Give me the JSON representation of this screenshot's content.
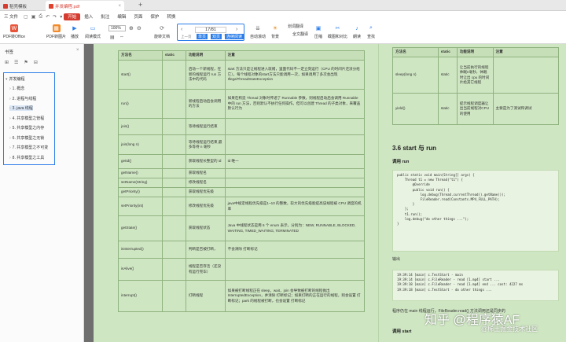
{
  "tabs": {
    "home_label": "稻壳模板",
    "doc_label": "并发编程.pdf",
    "add_label": "+"
  },
  "menu": {
    "file_label": "三 文件",
    "items": [
      "开始",
      "插入",
      "批注",
      "编辑",
      "页面",
      "保护",
      "转换"
    ],
    "active_index": 0
  },
  "toolbar": {
    "pdf_to_office": "PDF转Office",
    "pdf_to_image": "PDF转图片",
    "play": "播放",
    "read_mode": "阅读模式",
    "zoom": "100%",
    "rotate": "旋转文档",
    "single": "单页",
    "double": "双页",
    "continuous": "连续阅读",
    "autoscroll": "自动滚动",
    "background": "背景",
    "fulltext_translate": "全文翻译",
    "compress": "压缩",
    "screenshot_compare": "截图和对比",
    "read_aloud": "朗读",
    "find": "查找",
    "word_translate": "划词翻译",
    "page_current": "17",
    "page_total": "/81",
    "prev_label": "上一页",
    "next_label": "下一页"
  },
  "sidebar": {
    "title": "书签",
    "root": "并发编程",
    "items": [
      "1. 概念",
      "2. 进程与线程",
      "3. java 线程",
      "4. 共享模型之管程",
      "5. 共享模型之内存",
      "6. 共享模型之无锁",
      "7. 共享模型之不可变",
      "8. 共享模型之工具"
    ]
  },
  "table_main": {
    "headers": [
      "方法名",
      "static",
      "功能说明",
      "注意"
    ],
    "rows": [
      [
        "start()",
        "",
        "启动一个新线程，在新的线程运行 run 方法中的代码",
        "start 方法只是让线程进入就绪，里面代码不一定立刻运行（CPU 的时间片还没分给它）。每个线程对象的start方法只能调用一次，如果调用了多次会出现IllegalThreadStateException"
      ],
      [
        "run()",
        "",
        "新线程启动后会调用的方法",
        "如果在构造 Thread 对象时传递了 Runnable 参数，则线程启动后会调用 Runnable 中的 run 方法，否则默认不执行任何操作。但可以创建 Thread 的子类对象，来覆盖默认行为"
      ],
      [
        "join()",
        "",
        "等待线程运行结束",
        ""
      ],
      [
        "join(long n)",
        "",
        "等待线程运行结束,最多等待 n 毫秒",
        ""
      ],
      [
        "getId()",
        "",
        "获取线程长整型的 id",
        "id 唯一"
      ],
      [
        "getName()",
        "",
        "获取线程名",
        ""
      ],
      [
        "setName(String)",
        "",
        "修改线程名",
        ""
      ],
      [
        "getPriority()",
        "",
        "获取线程优先级",
        ""
      ],
      [
        "setPriority(int)",
        "",
        "修改线程优先级",
        "java中规定线程优先级是1~10 的整数，较大的优先级能提高该线程被 CPU 调度的机率"
      ],
      [
        "getState()",
        "",
        "获取线程状态",
        "Java 中线程状态是用 6 个 enum 表示，分别为：NEW, RUNNABLE, BLOCKED, WAITING, TIMED_WAITING, TERMINATED"
      ],
      [
        "isInterrupted()",
        "",
        "判断是否被打断，",
        "不会清除 打断标记"
      ],
      [
        "isAlive()",
        "",
        "线程是否存活（还没有运行完毕）",
        ""
      ],
      [
        "interrupt()",
        "",
        "打断线程",
        "如果被打断线程正在 sleep，wait，join 会导致被打断的线程抛出 InterruptedException，并清除 打断标记；如果打断的正在运行的线程，则会设置 打断标记；park 的线程被打断，也会设置 打断标记"
      ]
    ]
  },
  "table_right": {
    "headers": [
      "方法名",
      "static",
      "功能说明",
      "注意"
    ],
    "rows": [
      [
        "sleep(long n)",
        "static",
        "让当前执行的线程休眠n毫秒，休眠时让出 cpu 的时间片给其它线程",
        ""
      ],
      [
        "yield()",
        "static",
        "提示线程调度器让出当前线程对CPU的使用",
        "主要是为了测试和调试"
      ]
    ]
  },
  "right": {
    "heading": "3.6 start 与 run",
    "call_run": "调用 run",
    "code1": [
      "public static void main(String[] args) {",
      "    Thread t1 = new Thread(\"t1\") {",
      "        @Override",
      "        public void run() {",
      "            log.debug(Thread.currentThread().getName());",
      "            FileReader.read(Constants.MP4_FULL_PATH);",
      "        }",
      "    };",
      "",
      "    t1.run();",
      "    log.debug(\"do other things ...\");",
      "}"
    ],
    "output_label": "输出",
    "code2": [
      "19:39:14 [main] c.TestStart - main",
      "19:39:14 [main] c.FileReader - read [1.mp4] start ...",
      "19:39:18 [main] c.FileReader - read [1.mp4] end ... cost: 4227 ms",
      "19:39:18 [main] c.TestStart - do other things ..."
    ],
    "note": "程序仍在 main 线程运行，FileReader.read() 方法调用还是同步的",
    "call_start": "调用 start"
  },
  "watermark": {
    "main": "知乎 @程序猿AF",
    "sub": "@稀土掘金技术社区"
  },
  "colors": {
    "accent": "#d63b2f",
    "highlight": "#2b7de9",
    "doc_bg": "#cfe6c3"
  }
}
